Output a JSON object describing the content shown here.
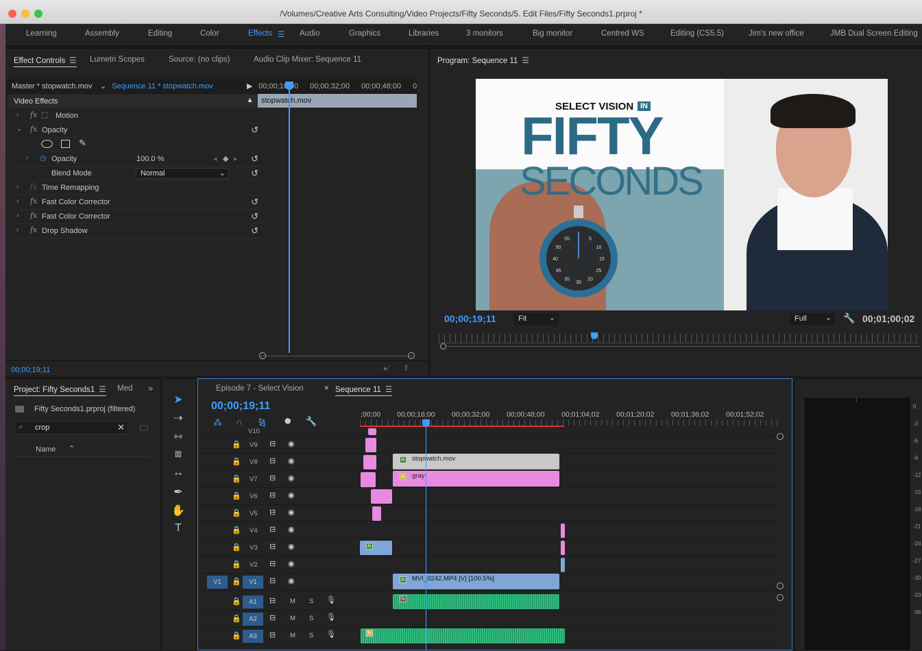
{
  "window": {
    "title": "/Volumes/Creative Arts Consulting/Video Projects/Fifty Seconds/5. Edit Files/Fifty Seconds1.prproj *"
  },
  "workspaces": [
    "Learning",
    "Assembly",
    "Editing",
    "Color",
    "Effects",
    "Audio",
    "Graphics",
    "Libraries",
    "3 monitors",
    "Big monitor",
    "Centred WS",
    "Editing (CS5.5)",
    "Jim's new office",
    "JMB Dual Screen Editing"
  ],
  "effect_panel": {
    "tabs": [
      "Effect Controls",
      "Lumetri Scopes",
      "Source: (no clips)",
      "Audio Clip Mixer: Sequence 11"
    ],
    "master": "Master * stopwatch.mov",
    "sequence": "Sequence 11 * stopwatch.mov",
    "ruler": [
      "00;00;16;00",
      "00;00;32;00",
      "00;00;48;00",
      "0"
    ],
    "clip_name": "stopwatch.mov",
    "section": "Video Effects",
    "effects": {
      "motion": "Motion",
      "opacity": "Opacity",
      "opacity_param": "Opacity",
      "opacity_value": "100.0 %",
      "blend_label": "Blend Mode",
      "blend_value": "Normal",
      "time_remap": "Time Remapping",
      "fcc1": "Fast Color Corrector",
      "fcc2": "Fast Color Corrector",
      "drop_shadow": "Drop Shadow"
    },
    "timecode": "00;00;19;11"
  },
  "program": {
    "tab": "Program: Sequence 11",
    "timecode": "00;00;19;11",
    "fit": "Fit",
    "quality": "Full",
    "duration": "00;01;00;02",
    "video_text": {
      "top": "SELECT VISION",
      "badge": "IN",
      "big1": "FIFTY",
      "big2": "SECONDS"
    },
    "stopwatch_marks": [
      "55",
      "5",
      "50",
      "10",
      "45",
      "15",
      "40",
      "20",
      "35",
      "25",
      "30"
    ]
  },
  "project": {
    "tab": "Project: Fifty Seconds1",
    "media_tab": "Med",
    "file": "Fifty Seconds1.prproj (filtered)",
    "search": "crop",
    "col_name": "Name"
  },
  "timeline": {
    "tabs": [
      "Episode 7 - Select Vision",
      "Sequence 11"
    ],
    "timecode": "00;00;19;11",
    "ruler": [
      ";00;00",
      "00;00;16;00",
      "00;00;32;00",
      "00;00;48;00",
      "00;01;04;02",
      "00;01;20;02",
      "00;01;36;02",
      "00;01;52;02"
    ],
    "tracks": [
      "V10",
      "V9",
      "V8",
      "V7",
      "V6",
      "V5",
      "V4",
      "V3",
      "V2",
      "V1",
      "A1",
      "A2",
      "A3"
    ],
    "source_patch": "V1",
    "clips": {
      "stopwatch": "stopwatch.mov",
      "gray": "gray",
      "mvi": "MVI_0242.MP4 [V] [100.5%]"
    },
    "audio_btn": {
      "m": "M",
      "s": "S"
    }
  },
  "meter": {
    "labels": [
      "0",
      "-3",
      "-6",
      "-9",
      "-12",
      "-15",
      "-18",
      "-21",
      "-24",
      "-27",
      "-30",
      "-33",
      "-36"
    ]
  },
  "colors": {
    "accent": "#3f9dff",
    "clip_pink": "#e88be0",
    "clip_blue": "#7fa6d6",
    "clip_gray": "#c8c8c8",
    "audio_green": "#2fbf7f"
  }
}
